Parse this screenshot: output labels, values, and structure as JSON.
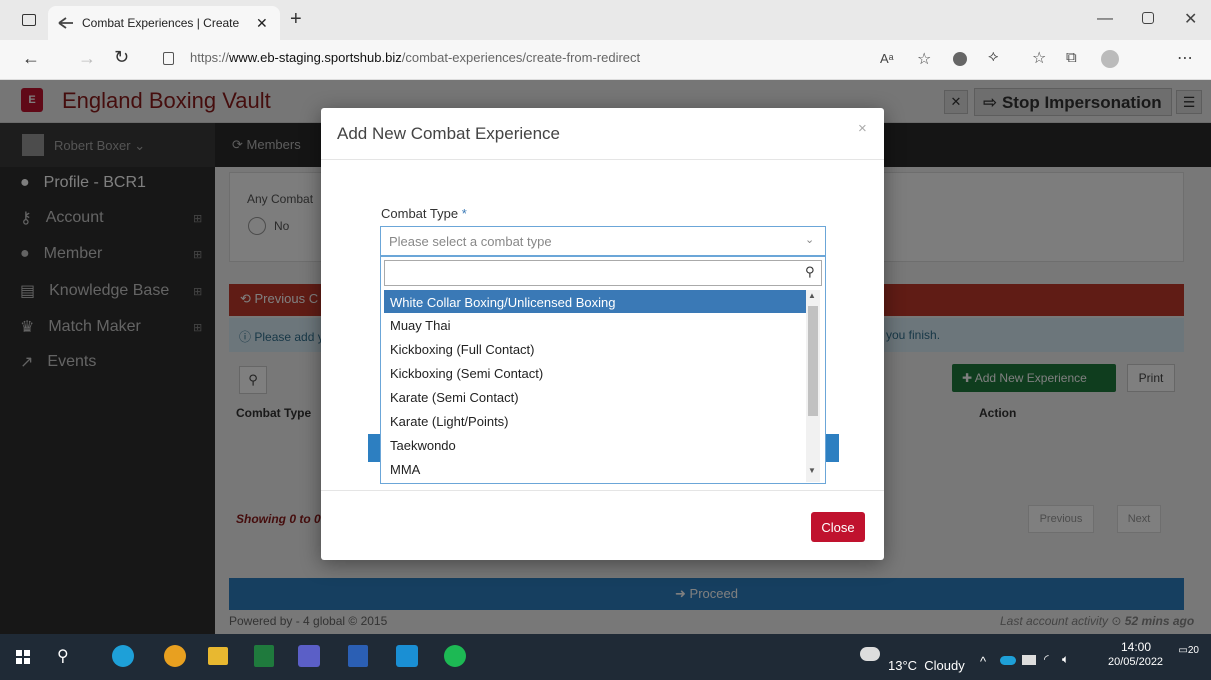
{
  "browser": {
    "tab_title": "Combat Experiences | Create",
    "new_tab": "+",
    "url_prefix": "https://",
    "url_domain": "www.eb-staging.sportshub.biz",
    "url_path": "/combat-experiences/create-from-redirect"
  },
  "app": {
    "brand": "England Boxing Vault",
    "stop_impersonation": "Stop Impersonation",
    "user": "Robert Boxer",
    "sidebar": [
      {
        "label": "Profile - BCR1",
        "icon": "user-icon"
      },
      {
        "label": "Account",
        "icon": "key-icon"
      },
      {
        "label": "Member",
        "icon": "users-icon"
      },
      {
        "label": "Knowledge Base",
        "icon": "book-icon"
      },
      {
        "label": "Match Maker",
        "icon": "trophy-icon"
      },
      {
        "label": "Events",
        "icon": "external-link-icon"
      }
    ],
    "members_tab": "Members",
    "any_combat": "Any Combat",
    "no_label": "No",
    "previous_section": "Previous C",
    "info_text": "Please add y",
    "info_suffix": "you finish.",
    "add_new_experience": "Add New Experience",
    "print": "Print",
    "col_combat_type": "Combat Type",
    "col_action": "Action",
    "showing": "Showing 0 to 0",
    "pager_previous": "Previous",
    "pager_next": "Next",
    "proceed": "Proceed",
    "footer": "Powered by - 4 global © 2015",
    "last_activity": "Last account activity",
    "last_activity_time": "52 mins ago"
  },
  "modal": {
    "title": "Add New Combat Experience",
    "combat_type_label": "Combat Type",
    "required_mark": "*",
    "select_placeholder": "Please select a combat type",
    "options": [
      "White Collar Boxing/Unlicensed Boxing",
      "Muay Thai",
      "Kickboxing (Full Contact)",
      "Kickboxing (Semi Contact)",
      "Karate (Semi Contact)",
      "Karate (Light/Points)",
      "Taekwondo",
      "MMA"
    ],
    "selected_index": 0,
    "close": "Close"
  },
  "taskbar": {
    "weather": "13°C  Cloudy",
    "time": "14:00",
    "date": "20/05/2022",
    "notifications": "20"
  },
  "colors": {
    "brand": "#8b1a1a",
    "accent": "#3a79b6",
    "danger": "#c0122e",
    "success": "#1f7a3d",
    "sidebar": "#2e2e2e"
  }
}
